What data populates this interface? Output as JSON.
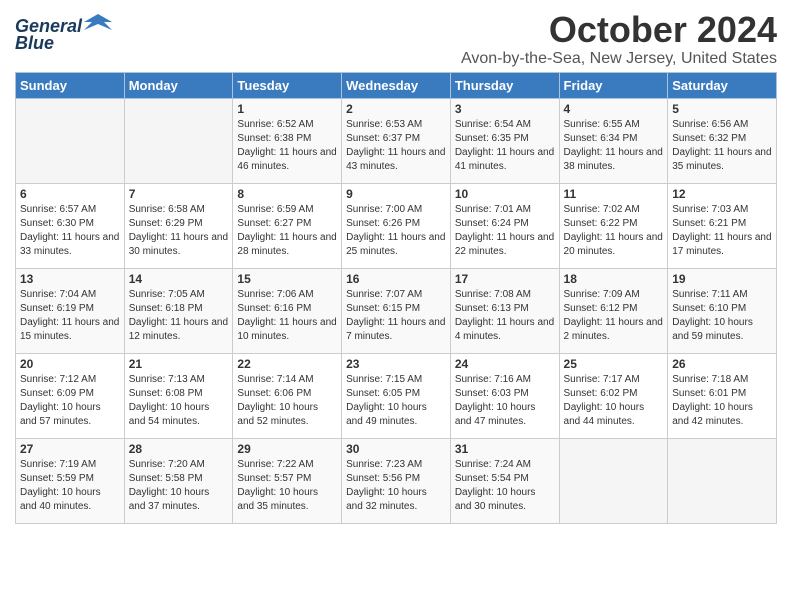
{
  "logo": {
    "line1": "General",
    "line2": "Blue"
  },
  "title": "October 2024",
  "location": "Avon-by-the-Sea, New Jersey, United States",
  "days_of_week": [
    "Sunday",
    "Monday",
    "Tuesday",
    "Wednesday",
    "Thursday",
    "Friday",
    "Saturday"
  ],
  "weeks": [
    [
      {
        "day": "",
        "info": ""
      },
      {
        "day": "",
        "info": ""
      },
      {
        "day": "1",
        "info": "Sunrise: 6:52 AM\nSunset: 6:38 PM\nDaylight: 11 hours and 46 minutes."
      },
      {
        "day": "2",
        "info": "Sunrise: 6:53 AM\nSunset: 6:37 PM\nDaylight: 11 hours and 43 minutes."
      },
      {
        "day": "3",
        "info": "Sunrise: 6:54 AM\nSunset: 6:35 PM\nDaylight: 11 hours and 41 minutes."
      },
      {
        "day": "4",
        "info": "Sunrise: 6:55 AM\nSunset: 6:34 PM\nDaylight: 11 hours and 38 minutes."
      },
      {
        "day": "5",
        "info": "Sunrise: 6:56 AM\nSunset: 6:32 PM\nDaylight: 11 hours and 35 minutes."
      }
    ],
    [
      {
        "day": "6",
        "info": "Sunrise: 6:57 AM\nSunset: 6:30 PM\nDaylight: 11 hours and 33 minutes."
      },
      {
        "day": "7",
        "info": "Sunrise: 6:58 AM\nSunset: 6:29 PM\nDaylight: 11 hours and 30 minutes."
      },
      {
        "day": "8",
        "info": "Sunrise: 6:59 AM\nSunset: 6:27 PM\nDaylight: 11 hours and 28 minutes."
      },
      {
        "day": "9",
        "info": "Sunrise: 7:00 AM\nSunset: 6:26 PM\nDaylight: 11 hours and 25 minutes."
      },
      {
        "day": "10",
        "info": "Sunrise: 7:01 AM\nSunset: 6:24 PM\nDaylight: 11 hours and 22 minutes."
      },
      {
        "day": "11",
        "info": "Sunrise: 7:02 AM\nSunset: 6:22 PM\nDaylight: 11 hours and 20 minutes."
      },
      {
        "day": "12",
        "info": "Sunrise: 7:03 AM\nSunset: 6:21 PM\nDaylight: 11 hours and 17 minutes."
      }
    ],
    [
      {
        "day": "13",
        "info": "Sunrise: 7:04 AM\nSunset: 6:19 PM\nDaylight: 11 hours and 15 minutes."
      },
      {
        "day": "14",
        "info": "Sunrise: 7:05 AM\nSunset: 6:18 PM\nDaylight: 11 hours and 12 minutes."
      },
      {
        "day": "15",
        "info": "Sunrise: 7:06 AM\nSunset: 6:16 PM\nDaylight: 11 hours and 10 minutes."
      },
      {
        "day": "16",
        "info": "Sunrise: 7:07 AM\nSunset: 6:15 PM\nDaylight: 11 hours and 7 minutes."
      },
      {
        "day": "17",
        "info": "Sunrise: 7:08 AM\nSunset: 6:13 PM\nDaylight: 11 hours and 4 minutes."
      },
      {
        "day": "18",
        "info": "Sunrise: 7:09 AM\nSunset: 6:12 PM\nDaylight: 11 hours and 2 minutes."
      },
      {
        "day": "19",
        "info": "Sunrise: 7:11 AM\nSunset: 6:10 PM\nDaylight: 10 hours and 59 minutes."
      }
    ],
    [
      {
        "day": "20",
        "info": "Sunrise: 7:12 AM\nSunset: 6:09 PM\nDaylight: 10 hours and 57 minutes."
      },
      {
        "day": "21",
        "info": "Sunrise: 7:13 AM\nSunset: 6:08 PM\nDaylight: 10 hours and 54 minutes."
      },
      {
        "day": "22",
        "info": "Sunrise: 7:14 AM\nSunset: 6:06 PM\nDaylight: 10 hours and 52 minutes."
      },
      {
        "day": "23",
        "info": "Sunrise: 7:15 AM\nSunset: 6:05 PM\nDaylight: 10 hours and 49 minutes."
      },
      {
        "day": "24",
        "info": "Sunrise: 7:16 AM\nSunset: 6:03 PM\nDaylight: 10 hours and 47 minutes."
      },
      {
        "day": "25",
        "info": "Sunrise: 7:17 AM\nSunset: 6:02 PM\nDaylight: 10 hours and 44 minutes."
      },
      {
        "day": "26",
        "info": "Sunrise: 7:18 AM\nSunset: 6:01 PM\nDaylight: 10 hours and 42 minutes."
      }
    ],
    [
      {
        "day": "27",
        "info": "Sunrise: 7:19 AM\nSunset: 5:59 PM\nDaylight: 10 hours and 40 minutes."
      },
      {
        "day": "28",
        "info": "Sunrise: 7:20 AM\nSunset: 5:58 PM\nDaylight: 10 hours and 37 minutes."
      },
      {
        "day": "29",
        "info": "Sunrise: 7:22 AM\nSunset: 5:57 PM\nDaylight: 10 hours and 35 minutes."
      },
      {
        "day": "30",
        "info": "Sunrise: 7:23 AM\nSunset: 5:56 PM\nDaylight: 10 hours and 32 minutes."
      },
      {
        "day": "31",
        "info": "Sunrise: 7:24 AM\nSunset: 5:54 PM\nDaylight: 10 hours and 30 minutes."
      },
      {
        "day": "",
        "info": ""
      },
      {
        "day": "",
        "info": ""
      }
    ]
  ]
}
